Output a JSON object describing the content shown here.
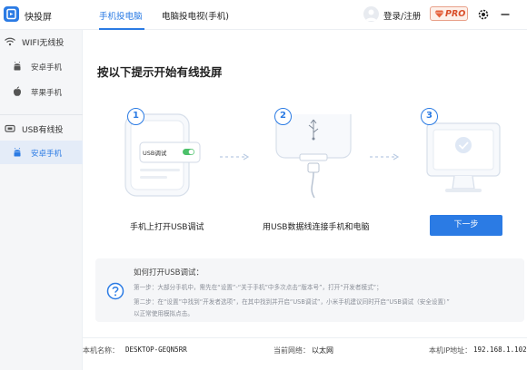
{
  "app": {
    "title": "快投屏"
  },
  "header": {
    "tabs": [
      {
        "label": "手机投电脑",
        "active": true
      },
      {
        "label": "电脑投电视(手机)",
        "active": false
      }
    ],
    "login_label": "登录/注册",
    "pro_label": "PRO"
  },
  "sidebar": {
    "wifi_section": "WIFI无线投",
    "usb_section": "USB有线投",
    "items": [
      {
        "label": "安卓手机"
      },
      {
        "label": "苹果手机"
      },
      {
        "label": "安卓手机"
      }
    ]
  },
  "main": {
    "title": "按以下提示开始有线投屏",
    "phone_screen_label": "USB调试",
    "steps": [
      {
        "num": "1",
        "label": "手机上打开USB调试"
      },
      {
        "num": "2",
        "label": "用USB数据线连接手机和电脑"
      },
      {
        "num": "3",
        "label": ""
      }
    ],
    "next_button": "下一步"
  },
  "help": {
    "title": "如何打开USB调试：",
    "lines": [
      "第一步：大部分手机中，需先在“设置”-“关于手机”中多次点击“版本号”，打开“开发者模式”；",
      "第二步：在“设置”中找到“开发者选项”，在其中找到并开启“USB调试”，小米手机建议同时开启“USB调试（安全设置）”",
      "以正常使用模拟点击。"
    ]
  },
  "footer": {
    "pc_name_label": "本机名称：",
    "pc_name_value": "DESKTOP-GEQN5RR",
    "network_label": "当前网络：",
    "network_value": "以太网",
    "ip_label": "本机IP地址：",
    "ip_value": "192.168.1.102"
  },
  "colors": {
    "accent": "#2b7be4",
    "pro": "#d94f2b"
  }
}
